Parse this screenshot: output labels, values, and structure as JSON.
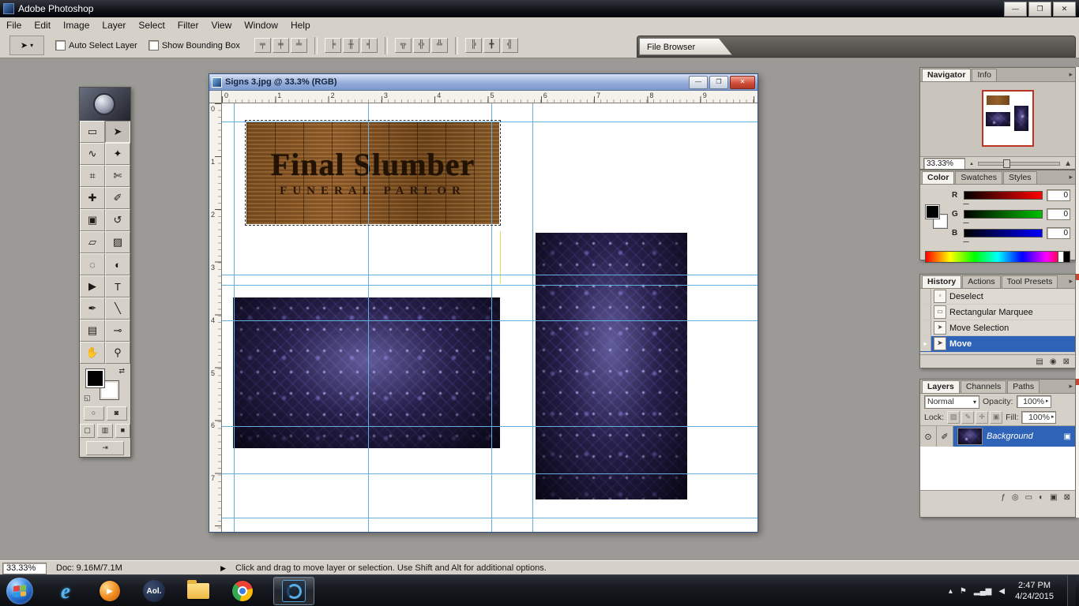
{
  "colors": {
    "highlight": "#2f63b8",
    "guide": "#64aee0",
    "close_red": "#cf4a35"
  },
  "titlebar": {
    "title": "Adobe Photoshop",
    "window_buttons": [
      {
        "name": "minimize-button",
        "glyph": "—"
      },
      {
        "name": "restore-button",
        "glyph": "❐"
      },
      {
        "name": "close-button",
        "glyph": "✕"
      }
    ]
  },
  "menubar": {
    "items": [
      "File",
      "Edit",
      "Image",
      "Layer",
      "Select",
      "Filter",
      "View",
      "Window",
      "Help"
    ]
  },
  "optionsbar": {
    "tool_glyph": "➤",
    "dropdown_glyph": "▾",
    "auto_select_label": "Auto Select Layer",
    "show_bounding_label": "Show Bounding Box",
    "align_buttons": [
      {
        "name": "align-top-edges",
        "glyph": "╤"
      },
      {
        "name": "align-vertical-centers",
        "glyph": "╪"
      },
      {
        "name": "align-bottom-edges",
        "glyph": "╧"
      },
      {
        "name": "align-left-edges",
        "glyph": "╞"
      },
      {
        "name": "align-horizontal-centers",
        "glyph": "╫"
      },
      {
        "name": "align-right-edges",
        "glyph": "╡"
      },
      {
        "name": "distribute-top-edges",
        "glyph": "╦"
      },
      {
        "name": "distribute-vertical-centers",
        "glyph": "╬"
      },
      {
        "name": "distribute-bottom-edges",
        "glyph": "╩"
      },
      {
        "name": "distribute-left-edges",
        "glyph": "╠"
      },
      {
        "name": "distribute-horizontal-centers",
        "glyph": "╋"
      },
      {
        "name": "distribute-right-edges",
        "glyph": "╣"
      }
    ],
    "file_browser_label": "File Browser"
  },
  "toolbox": {
    "tools": [
      {
        "name": "rectangular-marquee",
        "glyph": "▭"
      },
      {
        "name": "move",
        "glyph": "➤",
        "active": true
      },
      {
        "name": "lasso",
        "glyph": "∿"
      },
      {
        "name": "magic-wand",
        "glyph": "✦"
      },
      {
        "name": "crop",
        "glyph": "⌗"
      },
      {
        "name": "slice",
        "glyph": "✄"
      },
      {
        "name": "healing-brush",
        "glyph": "✚"
      },
      {
        "name": "brush",
        "glyph": "✐"
      },
      {
        "name": "clone-stamp",
        "glyph": "▣"
      },
      {
        "name": "history-brush",
        "glyph": "↺"
      },
      {
        "name": "eraser",
        "glyph": "▱"
      },
      {
        "name": "gradient",
        "glyph": "▨"
      },
      {
        "name": "blur",
        "glyph": "◌"
      },
      {
        "name": "dodge",
        "glyph": "◐"
      },
      {
        "name": "path-selection",
        "glyph": "▶"
      },
      {
        "name": "type",
        "glyph": "T"
      },
      {
        "name": "pen",
        "glyph": "✒"
      },
      {
        "name": "line",
        "glyph": "╲"
      },
      {
        "name": "notes",
        "glyph": "▤"
      },
      {
        "name": "eyedropper",
        "glyph": "⊸"
      },
      {
        "name": "hand",
        "glyph": "✋"
      },
      {
        "name": "zoom",
        "glyph": "⚲"
      }
    ],
    "swap_glyph": "⇄",
    "default_glyph": "◱",
    "quickmask": [
      {
        "name": "standard-mode-button",
        "glyph": "○"
      },
      {
        "name": "quick-mask-mode-button",
        "glyph": "◙"
      }
    ],
    "screen_modes": [
      {
        "name": "standard-screen-button",
        "glyph": "▢"
      },
      {
        "name": "fullscreen-menubar-button",
        "glyph": "▥"
      },
      {
        "name": "fullscreen-button",
        "glyph": "■"
      }
    ],
    "imageready_glyph": "⇥"
  },
  "document": {
    "title": "Signs 3.jpg @ 33.3% (RGB)",
    "window_buttons": [
      {
        "name": "doc-minimize-button",
        "glyph": "—"
      },
      {
        "name": "doc-restore-button",
        "glyph": "❐"
      },
      {
        "name": "doc-close-button",
        "glyph": "✕",
        "close": true
      }
    ],
    "ruler_top": [
      "0",
      "1",
      "2",
      "3",
      "4",
      "5",
      "6",
      "7",
      "8",
      "9"
    ],
    "ruler_left": [
      "0",
      "1",
      "2",
      "3",
      "4",
      "5",
      "6",
      "7"
    ],
    "guides": {
      "vertical": [
        15,
        185,
        341,
        393
      ],
      "horizontal": [
        23,
        217,
        230,
        275,
        409,
        469,
        525
      ]
    },
    "sign": {
      "line1": "Final Slumber",
      "line2": "FUNERAL PARLOR"
    }
  },
  "palettes": {
    "menu_glyph": "▸",
    "navigator": {
      "tabs": [
        "Navigator",
        "Info"
      ],
      "active": 0,
      "zoom": "33.33%",
      "zoom_out_glyph": "▲",
      "zoom_in_glyph": "▲"
    },
    "color": {
      "tabs": [
        "Color",
        "Swatches",
        "Styles"
      ],
      "active": 0,
      "channels": [
        {
          "label": "R",
          "value": "0",
          "color": "#ff0000"
        },
        {
          "label": "G",
          "value": "0",
          "color": "#00c000"
        },
        {
          "label": "B",
          "value": "0",
          "color": "#0000ff"
        }
      ]
    },
    "history": {
      "tabs": [
        "History",
        "Actions",
        "Tool Presets"
      ],
      "active": 0,
      "states": [
        {
          "label": "Deselect",
          "icon": "▫"
        },
        {
          "label": "Rectangular Marquee",
          "icon": "▭"
        },
        {
          "label": "Move Selection",
          "icon": "➤"
        },
        {
          "label": "Move",
          "icon": "➤",
          "selected": true
        }
      ],
      "footer_icons": [
        {
          "name": "new-document-from-state-icon",
          "glyph": "▤"
        },
        {
          "name": "new-snapshot-icon",
          "glyph": "◉"
        },
        {
          "name": "delete-state-icon",
          "glyph": "⊠"
        }
      ]
    },
    "layers": {
      "tabs": [
        "Layers",
        "Channels",
        "Paths"
      ],
      "active": 0,
      "blend_mode": "Normal",
      "dropdown_glyph": "▾",
      "spin_glyph": "▸",
      "opacity_label": "Opacity:",
      "opacity": "100%",
      "lock_label": "Lock:",
      "fill_label": "Fill:",
      "fill": "100%",
      "lock_icons": [
        {
          "name": "lock-transparency-icon",
          "glyph": "▨"
        },
        {
          "name": "lock-image-icon",
          "glyph": "✎"
        },
        {
          "name": "lock-position-icon",
          "glyph": "✛"
        },
        {
          "name": "lock-all-icon",
          "glyph": "▣"
        }
      ],
      "layer_name": "Background",
      "eye_glyph": "⊙",
      "brush_glyph": "✐",
      "lock_badge_glyph": "▣",
      "footer_icons": [
        {
          "name": "layer-effects-icon",
          "glyph": "ƒ"
        },
        {
          "name": "layer-mask-icon",
          "glyph": "◎"
        },
        {
          "name": "layer-set-icon",
          "glyph": "▭"
        },
        {
          "name": "adjustment-layer-icon",
          "glyph": "◐"
        },
        {
          "name": "new-layer-icon",
          "glyph": "▣"
        },
        {
          "name": "delete-layer-icon",
          "glyph": "⊠"
        }
      ]
    }
  },
  "statusbar": {
    "zoom": "33.33%",
    "doc_info": "Doc: 9.16M/7.1M",
    "menu_glyph": "▶",
    "hint": "Click and drag to move layer or selection.  Use Shift and Alt for additional options."
  },
  "taskbar": {
    "ie_glyph": "e",
    "wmp_glyph": "▶",
    "aol_label": "Aol.",
    "tray_icons": [
      {
        "name": "hidden-icons-icon",
        "glyph": "▴"
      },
      {
        "name": "action-center-flag-icon",
        "glyph": "⚑"
      },
      {
        "name": "network-icon",
        "glyph": "▂▄▆"
      },
      {
        "name": "speaker-icon",
        "glyph": "◀"
      }
    ],
    "time": "2:47 PM",
    "date": "4/24/2015"
  }
}
